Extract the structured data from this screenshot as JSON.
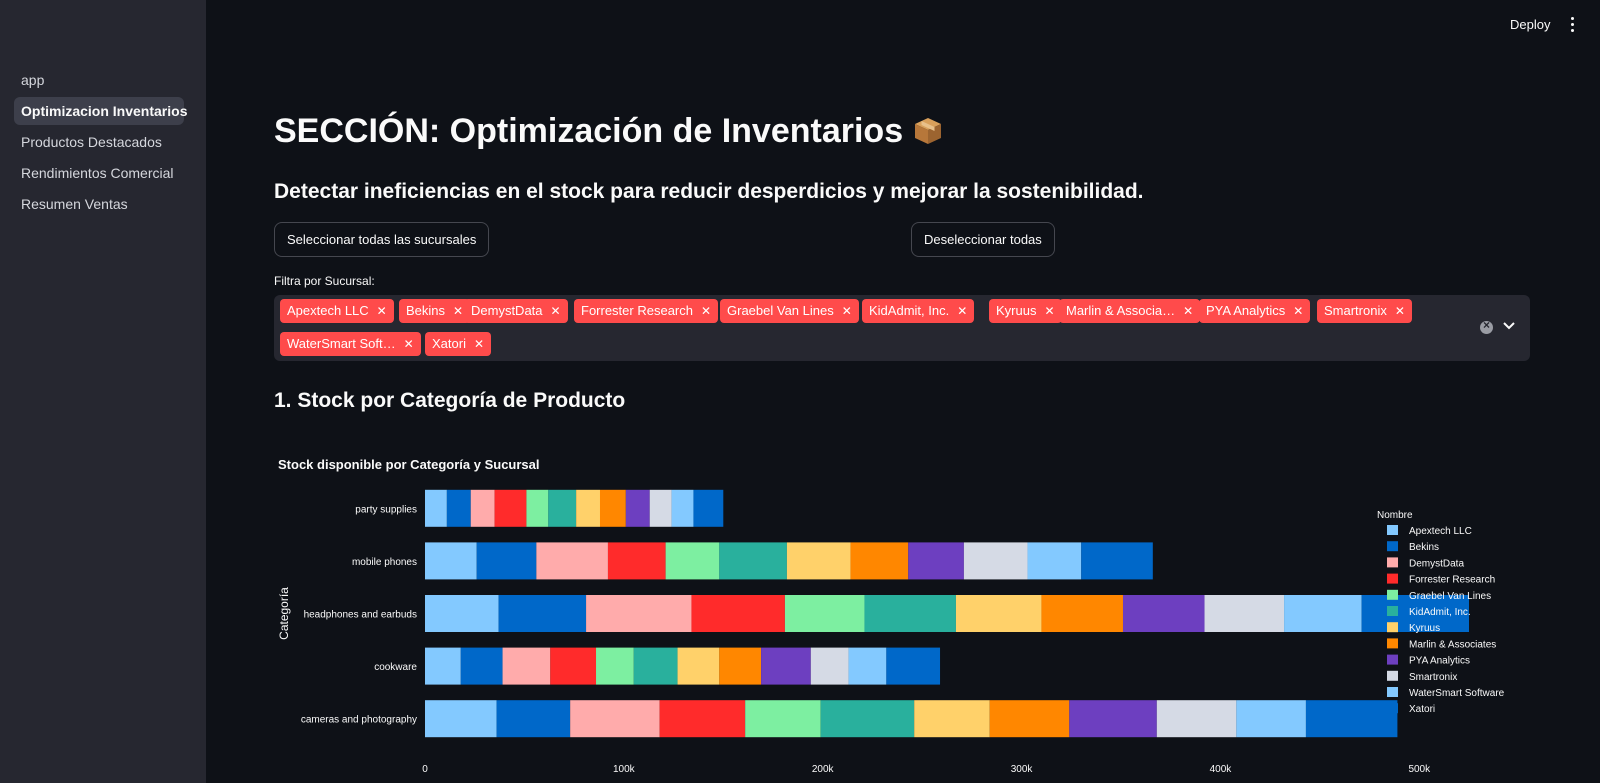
{
  "sidebar": {
    "items": [
      {
        "label": "app",
        "active": false
      },
      {
        "label": "Optimizacion Inventarios",
        "active": true
      },
      {
        "label": "Productos Destacados",
        "active": false
      },
      {
        "label": "Rendimientos Comercial",
        "active": false
      },
      {
        "label": "Resumen Ventas",
        "active": false
      }
    ]
  },
  "toolbar": {
    "deploy_label": "Deploy",
    "menu_icon": "kebab-menu-icon"
  },
  "main": {
    "title": "SECCIÓN: Optimización de Inventarios",
    "title_icon": "package-box-icon",
    "subtitle": "Detectar ineficiencias en el stock para reducir desperdicios y mejorar la sostenibilidad.",
    "select_all_label": "Seleccionar todas las sucursales",
    "deselect_all_label": "Deseleccionar todas",
    "filter": {
      "label": "Filtra por Sucursal:",
      "tags": [
        "Apextech LLC",
        "Bekins",
        "DemystData",
        "Forrester Research",
        "Graebel Van Lines",
        "KidAdmit, Inc.",
        "Kyruus",
        "Marlin & Associa…",
        "PYA Analytics",
        "Smartronix",
        "WaterSmart Soft…",
        "Xatori"
      ]
    },
    "section_title": "1. Stock por Categoría de Producto"
  },
  "colors": {
    "accent": "#ff4b4b",
    "background": "#0e1117",
    "sidebar": "#262730"
  },
  "chart_data": {
    "type": "bar",
    "orientation": "horizontal",
    "stacked": true,
    "title": "Stock disponible por Categoría y Sucursal",
    "ylabel": "Categoría",
    "xlabel": "",
    "xlim": [
      0,
      525000
    ],
    "x_ticks": [
      "0",
      "100k",
      "200k",
      "300k",
      "400k",
      "500k"
    ],
    "legend_title": "Nombre",
    "legend_position": "right",
    "categories": [
      "party supplies",
      "mobile phones",
      "headphones and earbuds",
      "cookware",
      "cameras and photography"
    ],
    "series": [
      {
        "name": "Apextech LLC",
        "color": "#83c9ff",
        "values": [
          11000,
          26000,
          37000,
          18000,
          36000
        ]
      },
      {
        "name": "Bekins",
        "color": "#0068c9",
        "values": [
          12000,
          30000,
          44000,
          21000,
          37000
        ]
      },
      {
        "name": "DemystData",
        "color": "#ffabab",
        "values": [
          12000,
          36000,
          53000,
          24000,
          45000
        ]
      },
      {
        "name": "Forrester Research",
        "color": "#ff2b2b",
        "values": [
          16000,
          29000,
          47000,
          23000,
          43000
        ]
      },
      {
        "name": "Graebel Van Lines",
        "color": "#7defa1",
        "values": [
          11000,
          27000,
          40000,
          19000,
          38000
        ]
      },
      {
        "name": "KidAdmit, Inc.",
        "color": "#29b09d",
        "values": [
          14000,
          34000,
          46000,
          22000,
          47000
        ]
      },
      {
        "name": "Kyruus",
        "color": "#ffd16a",
        "values": [
          12000,
          32000,
          43000,
          21000,
          38000
        ]
      },
      {
        "name": "Marlin & Associates",
        "color": "#ff8700",
        "values": [
          13000,
          29000,
          41000,
          21000,
          40000
        ]
      },
      {
        "name": "PYA Analytics",
        "color": "#6d3fc0",
        "values": [
          12000,
          28000,
          41000,
          25000,
          44000
        ]
      },
      {
        "name": "Smartronix",
        "color": "#d5dae5",
        "values": [
          11000,
          32000,
          40000,
          19000,
          40000
        ]
      },
      {
        "name": "WaterSmart Software",
        "color": "#83c9ff",
        "values": [
          11000,
          27000,
          39000,
          19000,
          35000
        ]
      },
      {
        "name": "Xatori",
        "color": "#0068c9",
        "values": [
          15000,
          36000,
          54000,
          27000,
          46000
        ]
      }
    ]
  }
}
